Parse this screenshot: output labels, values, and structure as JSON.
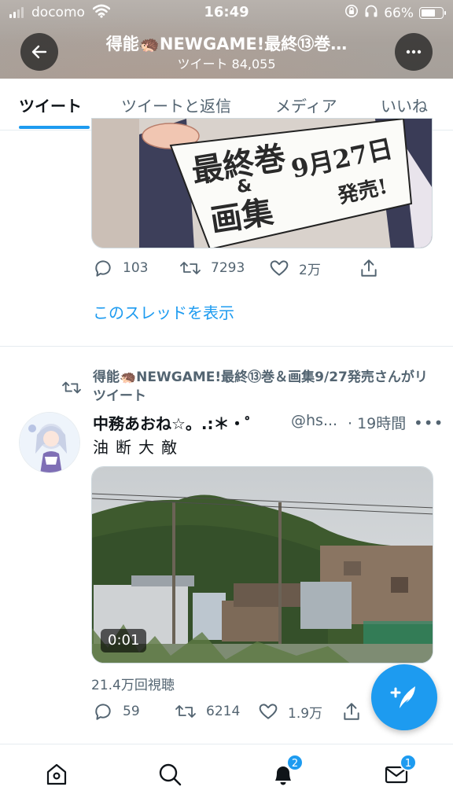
{
  "status_bar": {
    "carrier": "docomo",
    "time": "16:49",
    "battery": "66%",
    "battery_level": 0.66
  },
  "header": {
    "title": "得能🦔NEWGAME!最終⑬巻…",
    "subtitle": "ツイート 84,055"
  },
  "tabs": [
    {
      "label": "ツイート",
      "active": true
    },
    {
      "label": "ツイートと返信",
      "active": false
    },
    {
      "label": "メディア",
      "active": false
    },
    {
      "label": "いいね",
      "active": false
    }
  ],
  "tweet1": {
    "image_text": {
      "line1": "最終巻",
      "amp": "&",
      "line2": "画集",
      "date": "9月27日",
      "release": "発売!"
    },
    "replies": "103",
    "retweets": "7293",
    "likes": "2万",
    "thread_link": "このスレッドを表示"
  },
  "tweet2": {
    "retweeted_by": "得能🦔NEWGAME!最終⑬巻＆画集9/27発売さんがリツイート",
    "author_name": "中務あおね☆。.:＊・゜",
    "handle": "@hs...",
    "time": "· 19時間",
    "text": "油断大敵",
    "video_time": "0:01",
    "views": "21.4万回視聴",
    "replies": "59",
    "retweets": "6214",
    "likes": "1.9万"
  },
  "bottom_nav": {
    "notifications_badge": "2",
    "messages_badge": "1"
  },
  "colors": {
    "accent": "#1d9bf0",
    "secondary_text": "#536471",
    "primary_text": "#0f1419"
  }
}
